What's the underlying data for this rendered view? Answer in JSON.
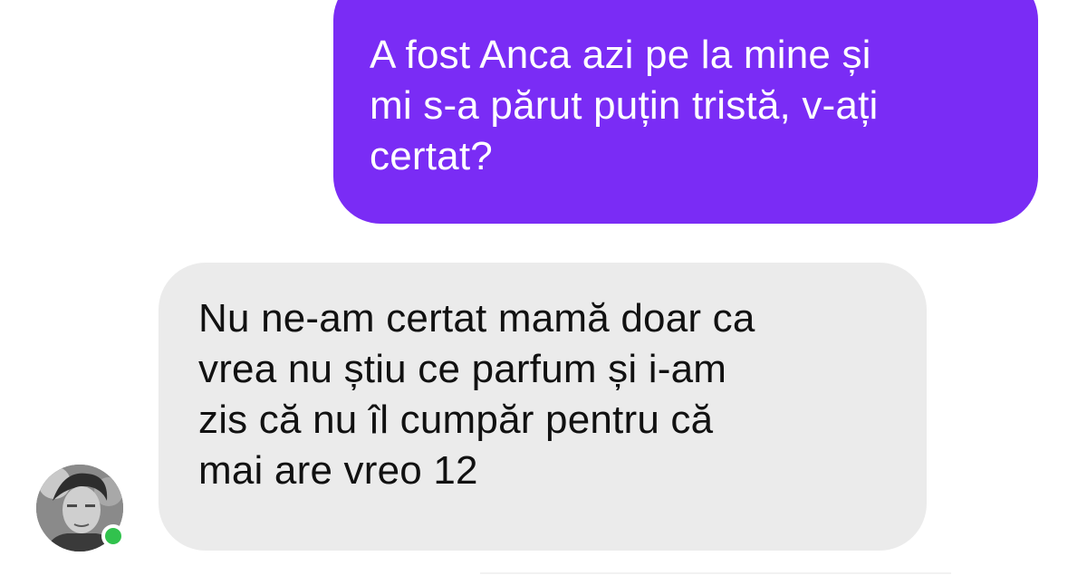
{
  "conversation": {
    "outgoing_message": {
      "lines": [
        "A fost Anca azi pe la mine și",
        "mi s-a părut puțin tristă, v-ați",
        "certat?"
      ]
    },
    "incoming_message": {
      "lines": [
        "Nu ne-am certat mamă doar ca",
        "vrea nu știu ce parfum și i-am",
        "zis că nu îl cumpăr pentru că",
        "mai are vreo 12"
      ]
    },
    "contact": {
      "avatar_icon": "user-avatar",
      "online_status": "online"
    }
  },
  "colors": {
    "outgoing_bubble": "#7a2cf5",
    "incoming_bubble": "#ebebeb",
    "online_indicator": "#31c24d"
  }
}
